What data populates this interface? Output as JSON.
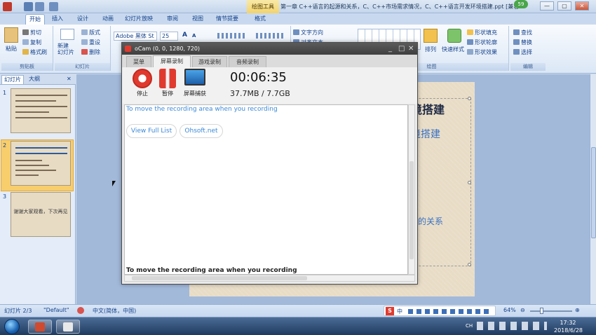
{
  "window": {
    "title": "第一章 C++语言的起源和关系，C、C++市场需求情况，C、C++语言开发环境搭建.ppt [兼容模式] - M...",
    "context_tool": "绘图工具",
    "badge": "59",
    "minimize": "—",
    "maximize": "▢",
    "close": "✕"
  },
  "ribbon": {
    "tabs": [
      "开始",
      "插入",
      "设计",
      "动画",
      "幻灯片放映",
      "审阅",
      "视图",
      "情节提要",
      "格式"
    ],
    "active_tab": "开始",
    "clipboard": {
      "paste": "粘贴",
      "cut": "剪切",
      "copy": "复制",
      "format_painter": "格式刷",
      "label": "剪贴板"
    },
    "slides": {
      "new_slide": "新建\n幻灯片",
      "layout": "版式",
      "reset": "重设",
      "delete": "删除",
      "label": "幻灯片"
    },
    "font": {
      "name": "Adobe 黑体 St",
      "size": "25",
      "grow": "A",
      "shrink": "A"
    },
    "paragraph": {
      "text_direction": "文字方向",
      "align_text": "对齐文本"
    },
    "drawing": {
      "arrange": "排列",
      "quick_styles": "快速样式",
      "shape_fill": "形状填充",
      "shape_outline": "形状轮廓",
      "shape_effects": "形状效果",
      "label": "绘图"
    },
    "editing": {
      "find": "查找",
      "replace": "替换",
      "select": "选择",
      "label": "编辑"
    }
  },
  "left_panel": {
    "tabs": [
      "幻灯片",
      "大纲"
    ],
    "close": "✕",
    "slides": [
      {
        "number": "1",
        "text": ""
      },
      {
        "number": "2",
        "text": ""
      },
      {
        "number": "3",
        "text": "谢谢大家观看，下次再见"
      }
    ]
  },
  "slide": {
    "title_partial": "境搭建",
    "subtitle_partial": "境搭建",
    "line_partial": "的关系"
  },
  "ocam": {
    "title": "oCam (0, 0, 1280, 720)",
    "minimize": "_",
    "maximize": "□",
    "close": "✕",
    "tabs": [
      "菜单",
      "屏幕录制",
      "游戏录制",
      "音频录制"
    ],
    "active_tab": "屏幕录制",
    "buttons": {
      "stop": "停止",
      "pause": "暂停",
      "screenshot": "屏幕捕获"
    },
    "timer": "00:06:35",
    "size": "37.7MB / 7.7GB",
    "content": {
      "top_line": "To move the recording area when you recording",
      "view_full_list": "View Full List",
      "ohsoft": "Ohsoft.net",
      "bottom_line": "To move the recording area when you recording"
    }
  },
  "status": {
    "slide_info": "幻灯片 2/3",
    "theme": "\"Default\"",
    "language": "中文(简体，中国)",
    "zoom": "64%",
    "ime": "中"
  },
  "taskbar": {
    "time": "17:32",
    "date": "2018/6/28",
    "tray_lang": "CH"
  },
  "colors": {
    "ocam_red": "#e03a2f",
    "link_blue": "#3d8ad8",
    "ribbon_text": "#15428b",
    "slide_bg": "#e8dcc6"
  }
}
